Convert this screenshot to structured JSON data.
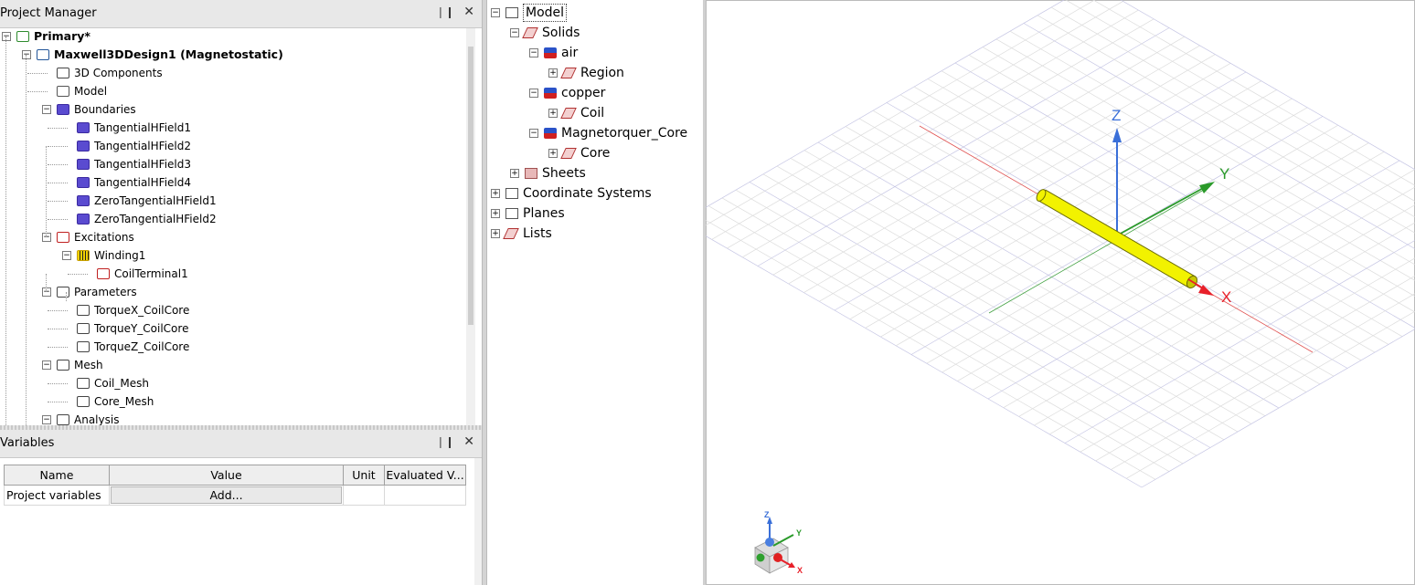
{
  "project_manager": {
    "title": "Project Manager",
    "tree": [
      {
        "label": "Primary*",
        "bold": true,
        "toggle": "-",
        "icon": "project-icon"
      },
      {
        "label": "Maxwell3DDesign1 (Magnetostatic)",
        "bold": true,
        "toggle": "-",
        "icon": "design-icon"
      },
      {
        "label": "3D Components",
        "icon": "components-icon"
      },
      {
        "label": "Model",
        "icon": "model-icon"
      },
      {
        "label": "Boundaries",
        "toggle": "-",
        "icon": "boundaries-icon"
      },
      {
        "label": "TangentialHField1",
        "icon": "boundary-icon"
      },
      {
        "label": "TangentialHField2",
        "icon": "boundary-icon"
      },
      {
        "label": "TangentialHField3",
        "icon": "boundary-icon"
      },
      {
        "label": "TangentialHField4",
        "icon": "boundary-icon"
      },
      {
        "label": "ZeroTangentialHField1",
        "icon": "boundary-icon"
      },
      {
        "label": "ZeroTangentialHField2",
        "icon": "boundary-icon"
      },
      {
        "label": "Excitations",
        "toggle": "-",
        "icon": "excitation-icon"
      },
      {
        "label": "Winding1",
        "toggle": "-",
        "icon": "winding-icon"
      },
      {
        "label": "CoilTerminal1",
        "icon": "coil-terminal-icon"
      },
      {
        "label": "Parameters",
        "toggle": "-",
        "icon": "parameters-icon"
      },
      {
        "label": "TorqueX_CoilCore",
        "icon": "torque-icon"
      },
      {
        "label": "TorqueY_CoilCore",
        "icon": "torque-icon"
      },
      {
        "label": "TorqueZ_CoilCore",
        "icon": "torque-icon"
      },
      {
        "label": "Mesh",
        "toggle": "-",
        "icon": "mesh-icon"
      },
      {
        "label": "Coil_Mesh",
        "icon": "mesh-op-icon"
      },
      {
        "label": "Core_Mesh",
        "icon": "mesh-op-icon"
      },
      {
        "label": "Analysis",
        "toggle": "-",
        "icon": "analysis-icon"
      }
    ]
  },
  "variables": {
    "title": "Variables",
    "columns": [
      "Name",
      "Value",
      "Unit",
      "Evaluated V..."
    ],
    "row_label": "Project variables",
    "add_label": "Add..."
  },
  "model_tree": {
    "items": [
      {
        "label": "Model",
        "toggle": "-",
        "icon": "model-icon"
      },
      {
        "label": "Solids",
        "toggle": "-",
        "icon": "solid-icon"
      },
      {
        "label": "air",
        "toggle": "-",
        "icon": "material-icon"
      },
      {
        "label": "Region",
        "toggle": "+",
        "icon": "solid-icon"
      },
      {
        "label": "copper",
        "toggle": "-",
        "icon": "material-icon"
      },
      {
        "label": "Coil",
        "toggle": "+",
        "icon": "solid-icon"
      },
      {
        "label": "Magnetorquer_Core",
        "toggle": "-",
        "icon": "material-icon"
      },
      {
        "label": "Core",
        "toggle": "+",
        "icon": "solid-icon"
      },
      {
        "label": "Sheets",
        "toggle": "+",
        "icon": "sheet-icon"
      },
      {
        "label": "Coordinate Systems",
        "toggle": "+",
        "icon": "coordinate-icon"
      },
      {
        "label": "Planes",
        "toggle": "+",
        "icon": "planes-icon"
      },
      {
        "label": "Lists",
        "toggle": "+",
        "icon": "lists-icon"
      }
    ]
  },
  "viewport": {
    "axis_x": "X",
    "axis_y": "Y",
    "axis_z": "Z",
    "colors": {
      "x": "#e8202a",
      "y": "#2a9a2a",
      "z": "#3a6fd8",
      "cylinder": "#f2f200"
    }
  }
}
